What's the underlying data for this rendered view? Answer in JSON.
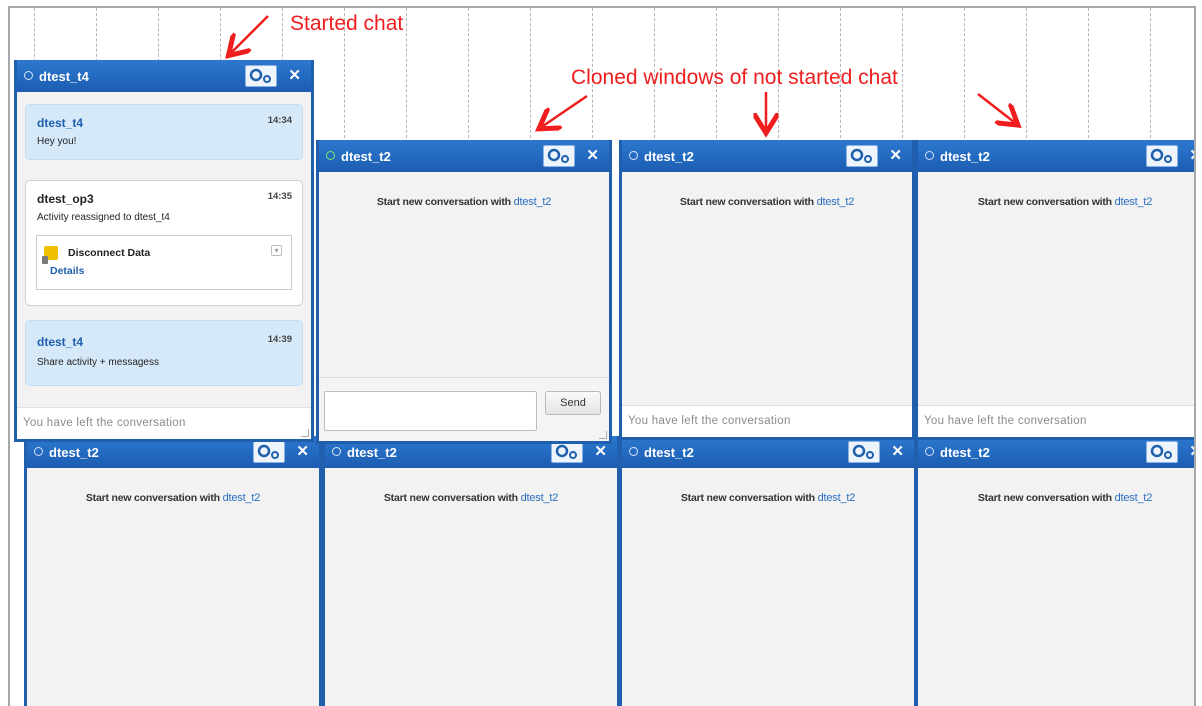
{
  "annotations": {
    "started": "Started chat",
    "cloned": "Cloned windows of not started chat"
  },
  "started_window": {
    "title": "dtest_t4",
    "messages": [
      {
        "name": "dtest_t4",
        "time": "14:34",
        "text": "Hey you!"
      },
      {
        "name": "dtest_op3",
        "time": "14:35",
        "text": "Activity reassigned to dtest_t4",
        "activity": {
          "title": "Disconnect Data",
          "link": "Details"
        }
      },
      {
        "name": "dtest_t4",
        "time": "14:39",
        "text": "Share activity + messagess"
      }
    ],
    "footer": "You have left the conversation"
  },
  "top_windows": [
    {
      "title": "dtest_t2",
      "start_prefix": "Start new conversation with",
      "user": "dtest_t2",
      "send_label": "Send",
      "status": "online"
    },
    {
      "title": "dtest_t2",
      "start_prefix": "Start new conversation with",
      "user": "dtest_t2",
      "footer": "You have left the conversation",
      "status": "offline"
    },
    {
      "title": "dtest_t2",
      "start_prefix": "Start new conversation with",
      "user": "dtest_t2",
      "footer": "You have left the conversation",
      "status": "offline"
    }
  ],
  "bottom_windows": [
    {
      "title": "dtest_t2",
      "start_prefix": "Start new conversation with",
      "user": "dtest_t2"
    },
    {
      "title": "dtest_t2",
      "start_prefix": "Start new conversation with",
      "user": "dtest_t2"
    },
    {
      "title": "dtest_t2",
      "start_prefix": "Start new conversation with",
      "user": "dtest_t2"
    },
    {
      "title": "dtest_t2",
      "start_prefix": "Start new conversation with",
      "user": "dtest_t2"
    }
  ],
  "colors": {
    "titlebar": "#1f5fae",
    "annotation": "#ef1d1d",
    "link": "#2a6ec1"
  },
  "icons": {
    "settings": "gear-icon",
    "close": "close-icon",
    "status": "status-dot-icon"
  }
}
